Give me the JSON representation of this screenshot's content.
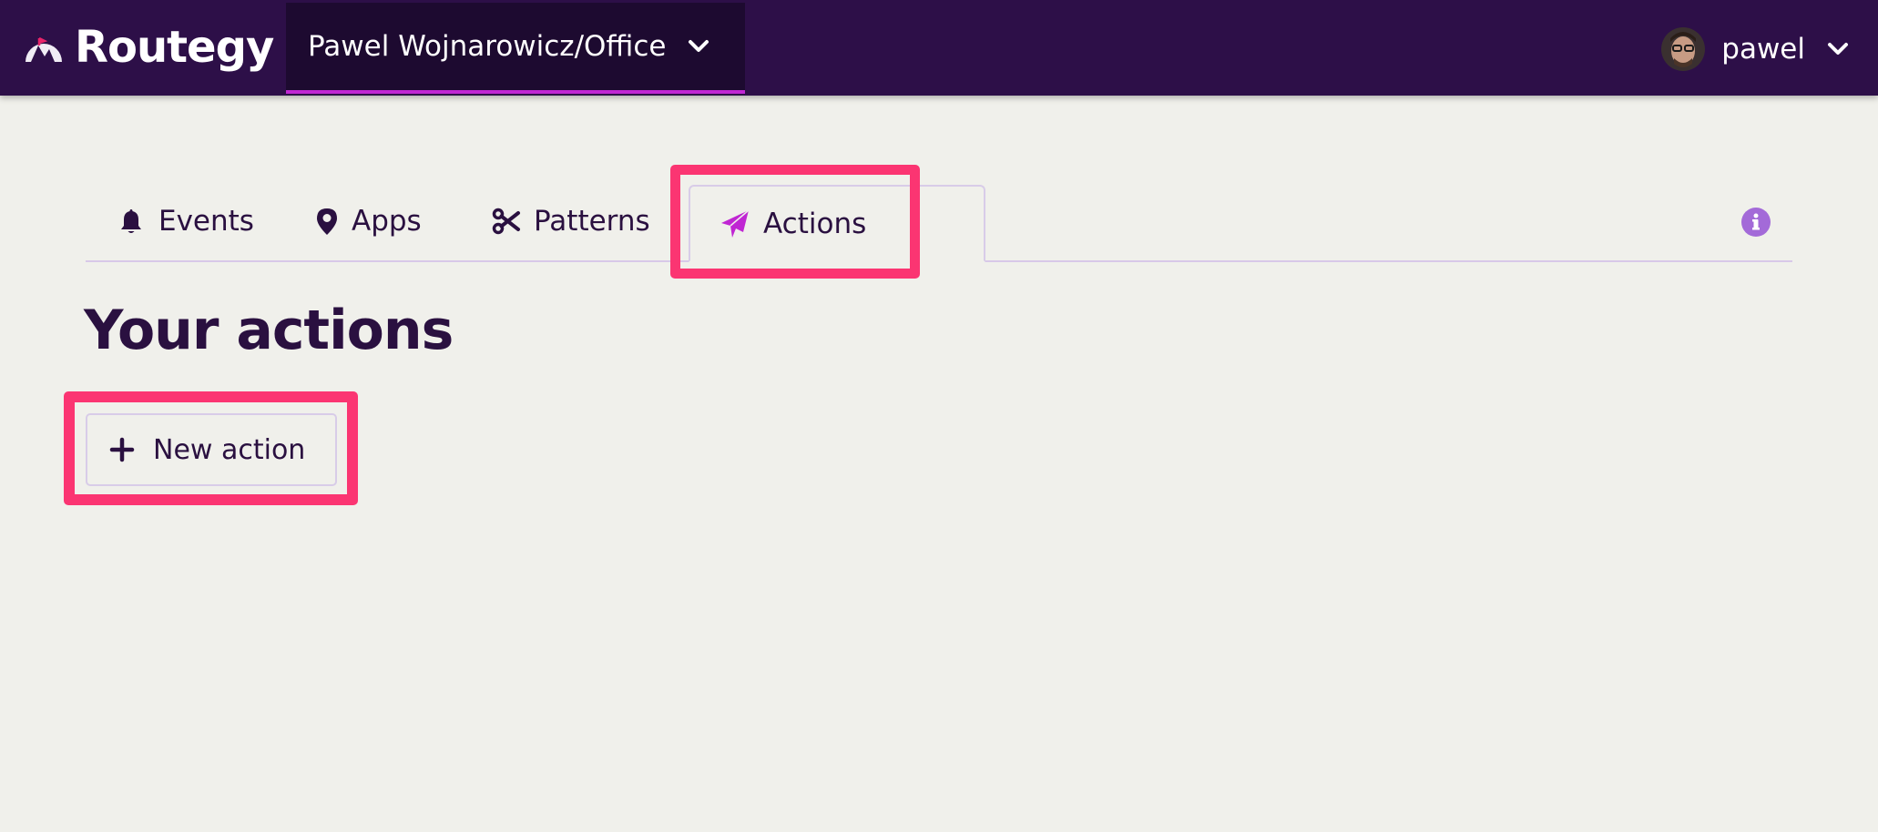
{
  "colors": {
    "topbar": "#2d0f48",
    "org_switcher_bg": "#1d0a30",
    "accent": "#c026d3",
    "highlight": "#fb3572",
    "page_bg": "#f0f0eb",
    "text": "#2a1040",
    "info": "#a36ad8"
  },
  "header": {
    "brand": "Routegy",
    "org_selector": "Pawel Wojnarowicz/Office",
    "user": "pawel"
  },
  "tabs": [
    {
      "label": "Events",
      "icon": "bell-icon"
    },
    {
      "label": "Apps",
      "icon": "map-pin-icon"
    },
    {
      "label": "Patterns",
      "icon": "scissors-icon"
    },
    {
      "label": "Actions",
      "icon": "paper-plane-icon",
      "active": true
    }
  ],
  "main": {
    "title": "Your actions",
    "new_action_label": "New action"
  }
}
